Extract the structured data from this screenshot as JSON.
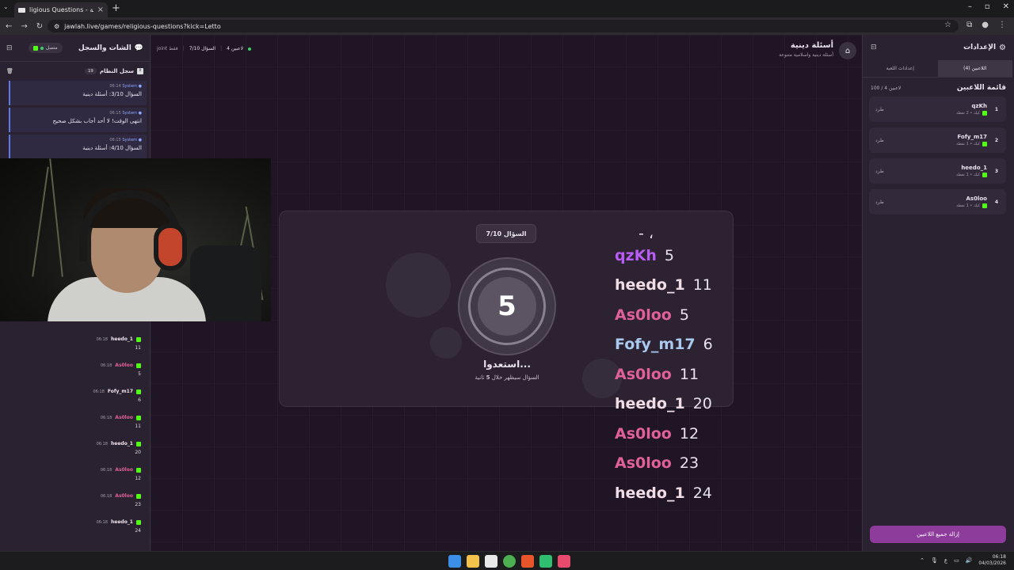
{
  "browser": {
    "tab_title": "ligious Questions - أسئلة دينية",
    "url": "jawlah.live/games/religious-questions?kick=Letto"
  },
  "chat_panel": {
    "title": "الشات والسجل",
    "connection": "متصل",
    "syslog_title": "سجل النظام",
    "syslog_count": "19",
    "syslog": [
      {
        "sender": "System",
        "time": "06:14",
        "text": "السؤال 3/10: أسئلة دينية"
      },
      {
        "sender": "System",
        "time": "06:15",
        "text": "انتهى الوقت! لا أحد أجاب بشكل صحيح"
      },
      {
        "sender": "System",
        "time": "06:15",
        "text": "السؤال 4/10: أسئلة دينية"
      }
    ],
    "messages": [
      {
        "user": "heedo_1",
        "time": "06:18",
        "text": "11",
        "color": "#f2e3ee"
      },
      {
        "user": "As0loo",
        "time": "06:18",
        "text": "5",
        "color": "#e0609a"
      },
      {
        "user": "Fofy_m17",
        "time": "06:18",
        "text": "6",
        "color": "#f2e3ee"
      },
      {
        "user": "As0loo",
        "time": "06:18",
        "text": "11",
        "color": "#e0609a"
      },
      {
        "user": "heedo_1",
        "time": "06:18",
        "text": "20",
        "color": "#f2e3ee"
      },
      {
        "user": "As0loo",
        "time": "06:18",
        "text": "12",
        "color": "#e0609a"
      },
      {
        "user": "As0loo",
        "time": "06:18",
        "text": "23",
        "color": "#e0609a"
      },
      {
        "user": "heedo_1",
        "time": "06:18",
        "text": "24",
        "color": "#f2e3ee"
      }
    ]
  },
  "header": {
    "players_online": "4 لاعبين",
    "question_progress": "السؤال 7/10",
    "join_note": "joint فقط",
    "game_title": "أسئلة دينية",
    "game_subtitle": "أسئلة دينية واسلامية متنوعة"
  },
  "countdown": {
    "badge": "السؤال 7/10",
    "number": "5",
    "ready": "استعدوا...",
    "sub_prefix": "السؤال سيظهر خلال",
    "sub_seconds": "5",
    "sub_suffix": "ثانية"
  },
  "overlay_chat": [
    {
      "user": "qzKh",
      "value": "5",
      "color": "#b85cf2"
    },
    {
      "user": "heedo_1",
      "value": "11",
      "color": "#f1dde6"
    },
    {
      "user": "As0loo",
      "value": "5",
      "color": "#e0609a"
    },
    {
      "user": "Fofy_m17",
      "value": "6",
      "color": "#a9c9ee"
    },
    {
      "user": "As0loo",
      "value": "11",
      "color": "#e0609a"
    },
    {
      "user": "heedo_1",
      "value": "20",
      "color": "#f1dde6"
    },
    {
      "user": "As0loo",
      "value": "12",
      "color": "#e0609a"
    },
    {
      "user": "As0loo",
      "value": "23",
      "color": "#e0609a"
    },
    {
      "user": "heedo_1",
      "value": "24",
      "color": "#f1dde6"
    }
  ],
  "settings": {
    "title": "الإعدادات",
    "tab_players": "اللاعبين (4)",
    "tab_game": "إعدادات اللعبة",
    "list_title": "قائمة اللاعبين",
    "list_count": "100 / 4 لاعبين",
    "kick_label": "طرد",
    "players": [
      {
        "rank": "1",
        "name": "qzKh",
        "score": "كيك • 2 نقطة"
      },
      {
        "rank": "2",
        "name": "Fofy_m17",
        "score": "كيك • 1 نقطة"
      },
      {
        "rank": "3",
        "name": "heedo_1",
        "score": "كيك • 1 نقطة"
      },
      {
        "rank": "4",
        "name": "As0loo",
        "score": "كيك • 1 نقطة"
      }
    ],
    "remove_all": "إزالة جميع اللاعبين"
  },
  "taskbar": {
    "lang": "ع",
    "time": "06:18",
    "date": "04/03/2026"
  },
  "colors": {
    "accent": "#8e3c9c",
    "kick_green": "#53fc18",
    "system_blue": "#5b7be0"
  }
}
